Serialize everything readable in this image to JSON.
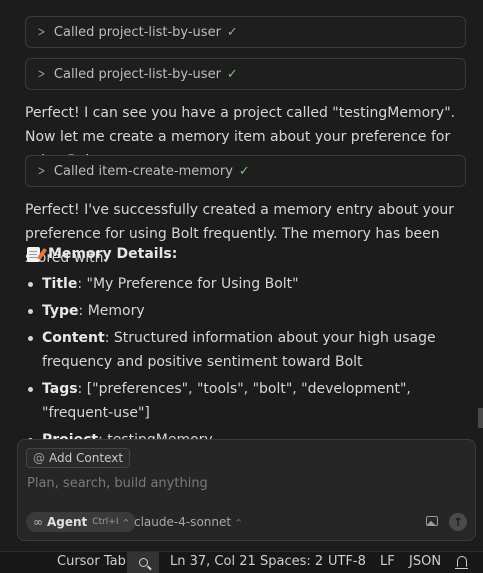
{
  "chat": {
    "tool_calls": [
      {
        "label": "Called project-list-by-user"
      },
      {
        "label": "Called project-list-by-user"
      },
      {
        "label": "Called item-create-memory"
      }
    ],
    "messages": [
      "Perfect! I can see you have a project called \"testingMemory\". Now let me create a memory item about your preference for using Bolt:",
      "Perfect! I've successfully created a memory entry about your preference for using Bolt frequently. The memory has been stored with:"
    ],
    "details_title": "Memory Details:",
    "details": [
      {
        "key": "Title",
        "value": ": \"My Preference for Using Bolt\""
      },
      {
        "key": "Type",
        "value": ": Memory"
      },
      {
        "key": "Content",
        "value": ": Structured information about your high usage frequency and positive sentiment toward Bolt"
      },
      {
        "key": "Tags",
        "value": ": [\"preferences\", \"tools\", \"bolt\", \"development\", \"frequent-use\"]"
      },
      {
        "key": "Project",
        "value": ": testingMemory"
      }
    ]
  },
  "composer": {
    "add_context_label": "Add Context",
    "placeholder": "Plan, search, build anything",
    "agent_label": "Agent",
    "agent_shortcut": "Ctrl+I",
    "model_label": "claude-4-sonnet"
  },
  "status_bar": {
    "cursor_tab": "Cursor Tab",
    "position": "Ln 37, Col 21",
    "spaces": "Spaces: 2",
    "encoding": "UTF-8",
    "eol": "LF",
    "language": "JSON"
  },
  "colors": {
    "background": "#1c1c1c",
    "check": "#7fbf7f",
    "status_bar": "#181818"
  }
}
